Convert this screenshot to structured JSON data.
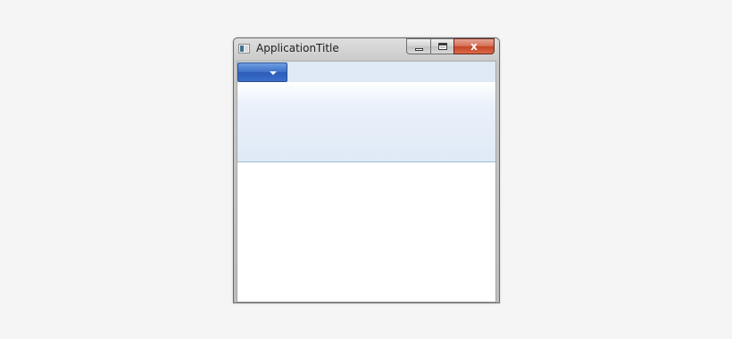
{
  "window": {
    "title": "ApplicationTitle",
    "controls": {
      "close_glyph": "x",
      "minimize_icon": "minimize-icon",
      "maximize_icon": "maximize-icon"
    }
  },
  "ribbon": {
    "application_menu_icon": "chevron-down-icon"
  },
  "colors": {
    "page_background": "#f5f5f5",
    "ribbon_background": "#dfe9f5",
    "application_button": "#3d6fc8",
    "close_button": "#c34524",
    "client_background": "#ffffff"
  }
}
